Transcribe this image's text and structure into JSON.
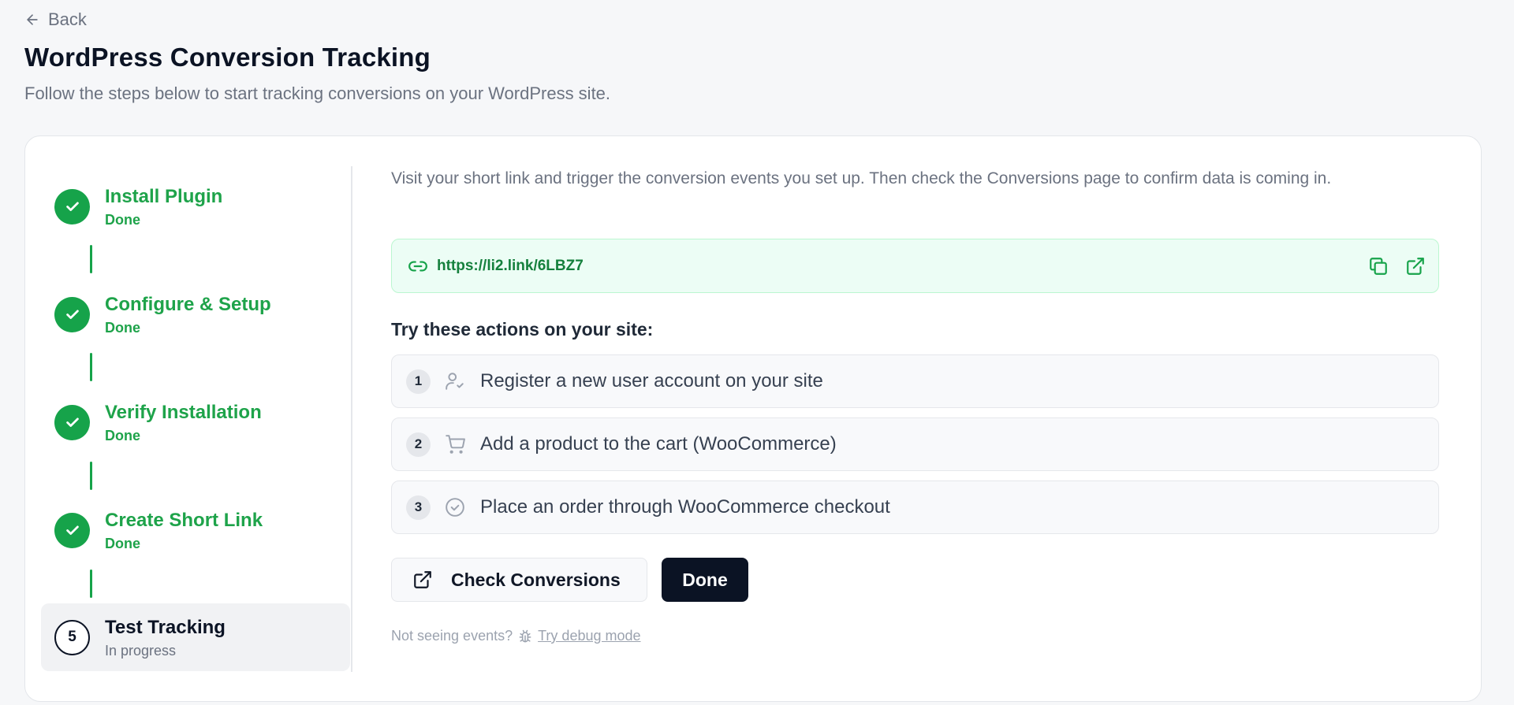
{
  "header": {
    "back_label": "Back",
    "title": "WordPress Conversion Tracking",
    "subtitle": "Follow the steps below to start tracking conversions on your WordPress site."
  },
  "steps": [
    {
      "label": "Install Plugin",
      "status": "Done",
      "state": "done"
    },
    {
      "label": "Configure & Setup",
      "status": "Done",
      "state": "done"
    },
    {
      "label": "Verify Installation",
      "status": "Done",
      "state": "done"
    },
    {
      "label": "Create Short Link",
      "status": "Done",
      "state": "done"
    },
    {
      "number": "5",
      "label": "Test Tracking",
      "status": "In progress",
      "state": "active"
    }
  ],
  "main": {
    "intro": "Visit your short link and trigger the conversion events you set up. Then check the Conversions page to confirm data is coming in.",
    "short_link": "https://li2.link/6LBZ7",
    "try_title": "Try these actions on your site:",
    "actions": [
      {
        "number": "1",
        "icon": "user-check-icon",
        "text": "Register a new user account on your site"
      },
      {
        "number": "2",
        "icon": "cart-icon",
        "text": "Add a product to the cart (WooCommerce)"
      },
      {
        "number": "3",
        "icon": "check-circle-icon",
        "text": "Place an order through WooCommerce checkout"
      }
    ],
    "check_button": "Check Conversions",
    "done_button": "Done",
    "debug_prefix": "Not seeing events?",
    "debug_link": "Try debug mode"
  },
  "colors": {
    "accent_green": "#16a34a",
    "dark": "#0b1324",
    "link_bg": "#ecfdf5"
  }
}
